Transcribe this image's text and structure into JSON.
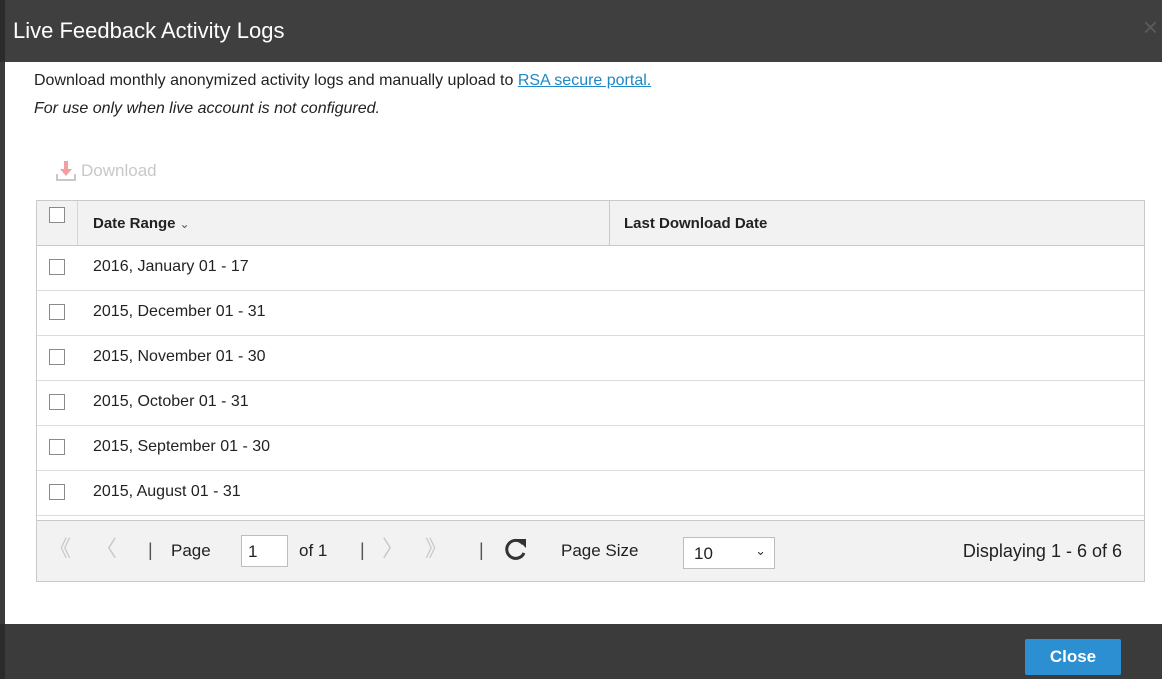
{
  "dialog": {
    "title": "Live Feedback Activity Logs",
    "close_glyph": "×"
  },
  "intro": {
    "line1_text": "Download monthly anonymized activity logs and manually upload to ",
    "line1_link": "RSA secure portal.",
    "line2": "For use only when live account is not configured."
  },
  "toolbar": {
    "download_label": "Download"
  },
  "grid": {
    "columns": [
      "Date Range",
      "Last Download Date"
    ],
    "rows": [
      {
        "date_range": "2016, January 01 - 17",
        "last_download": ""
      },
      {
        "date_range": "2015, December 01 - 31",
        "last_download": ""
      },
      {
        "date_range": "2015, November 01 - 30",
        "last_download": ""
      },
      {
        "date_range": "2015, October 01 - 31",
        "last_download": ""
      },
      {
        "date_range": "2015, September 01 - 30",
        "last_download": ""
      },
      {
        "date_range": "2015, August 01 - 31",
        "last_download": ""
      }
    ]
  },
  "pager": {
    "page_label": "Page",
    "page_value": "1",
    "of_label": "of 1",
    "page_size_label": "Page Size",
    "page_size_value": "10",
    "display_text": "Displaying 1 - 6 of 6"
  },
  "footer": {
    "close_label": "Close"
  },
  "colors": {
    "accent": "#2b8fd1",
    "link": "#1e88c8",
    "titlebar": "#3f3f3f"
  }
}
